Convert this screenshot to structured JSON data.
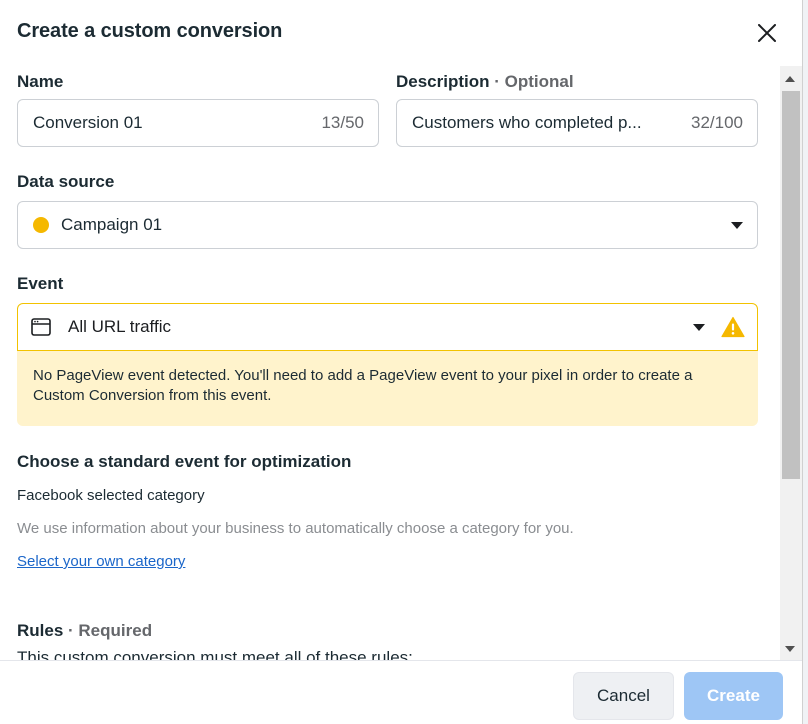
{
  "dialog": {
    "title": "Create a custom conversion"
  },
  "name_field": {
    "label": "Name",
    "value": "Conversion 01",
    "count": "13/50"
  },
  "description_field": {
    "label": "Description",
    "optional_tag": " · Optional",
    "value": "Customers who completed p...",
    "count": "32/100"
  },
  "data_source": {
    "label": "Data source",
    "value": "Campaign 01",
    "dot_color": "#f5b800"
  },
  "event": {
    "label": "Event",
    "value": "All URL traffic",
    "warning": "No PageView event detected. You'll need to add a PageView event to your pixel in order to create a Custom Conversion from this event.",
    "warning_color": "#f2c200",
    "warning_bg": "#fff3cc"
  },
  "optimization": {
    "title": "Choose a standard event for optimization",
    "selected": "Facebook selected category",
    "description": "We use information about your business to automatically choose a category for you.",
    "link": "Select your own category"
  },
  "rules": {
    "label": "Rules",
    "required_tag": " · Required",
    "description": "This custom conversion must meet all of these rules:"
  },
  "footer": {
    "cancel_label": "Cancel",
    "create_label": "Create",
    "create_color": "#9ec6f5"
  }
}
